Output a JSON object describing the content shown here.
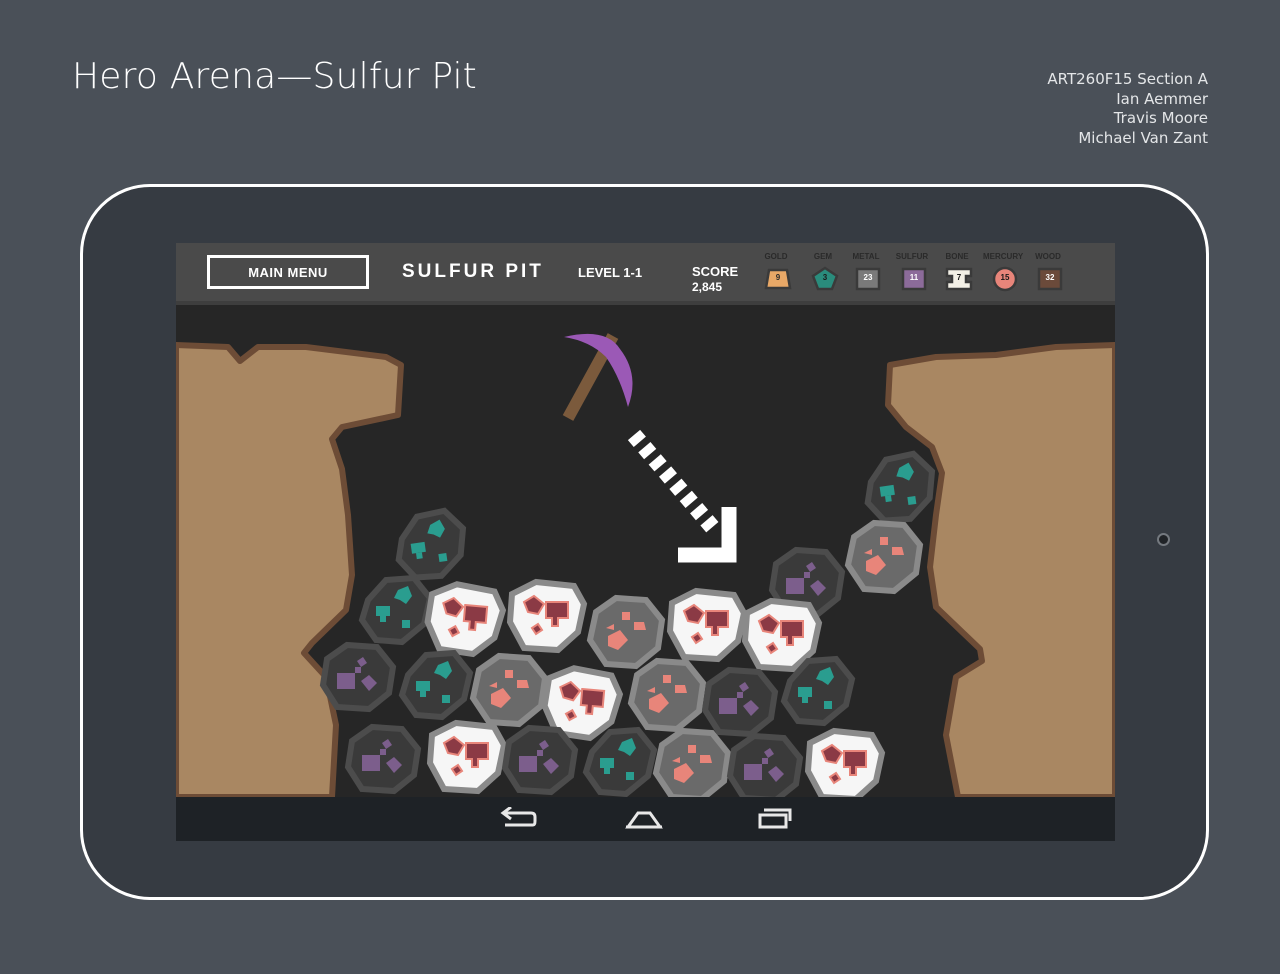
{
  "page": {
    "title": "Hero Arena—Sulfur Pit",
    "credits": [
      "ART260F15 Section A",
      "Ian Aemmer",
      "Travis Moore",
      "Michael Van Zant"
    ]
  },
  "hud": {
    "main_menu_label": "MAIN MENU",
    "level_title": "SULFUR PIT",
    "level_label": "LEVEL 1-1",
    "score_label": "SCORE",
    "score_value": "2,845",
    "resources": [
      {
        "name": "GOLD",
        "count": "9",
        "color": "#e8a867",
        "icon": "gold-trapezoid-icon"
      },
      {
        "name": "GEM",
        "count": "3",
        "color": "#2a8c7c",
        "icon": "gem-pentagon-icon"
      },
      {
        "name": "METAL",
        "count": "23",
        "color": "#7a7a7a",
        "icon": "metal-square-icon"
      },
      {
        "name": "SULFUR",
        "count": "11",
        "color": "#8c6b9a",
        "icon": "sulfur-square-icon"
      },
      {
        "name": "BONE",
        "count": "7",
        "color": "#f3f0e6",
        "icon": "bone-icon"
      },
      {
        "name": "MERCURY",
        "count": "15",
        "color": "#e8857a",
        "icon": "mercury-circle-icon"
      },
      {
        "name": "WOOD",
        "count": "32",
        "color": "#6b4a3a",
        "icon": "wood-square-icon"
      }
    ]
  },
  "colors": {
    "background": "#4a5058",
    "tablet": "#363b42",
    "dirt": "#a98762",
    "dirt_edge": "#6d4c36",
    "pickaxe_head": "#9b59b6",
    "pickaxe_handle": "#7b5a3c",
    "gem_ore": "#2a9d8f",
    "sulfur_ore": "#7c5e8c",
    "mercury_ore": "#e8857a",
    "bone_ore": "#8b3a45"
  },
  "icons": {
    "pickaxe": "pickaxe-cursor-icon",
    "arrow": "dashed-arrow-icon",
    "nav_back": "back-arrow-icon",
    "nav_home": "home-icon",
    "nav_recents": "recents-icon"
  }
}
